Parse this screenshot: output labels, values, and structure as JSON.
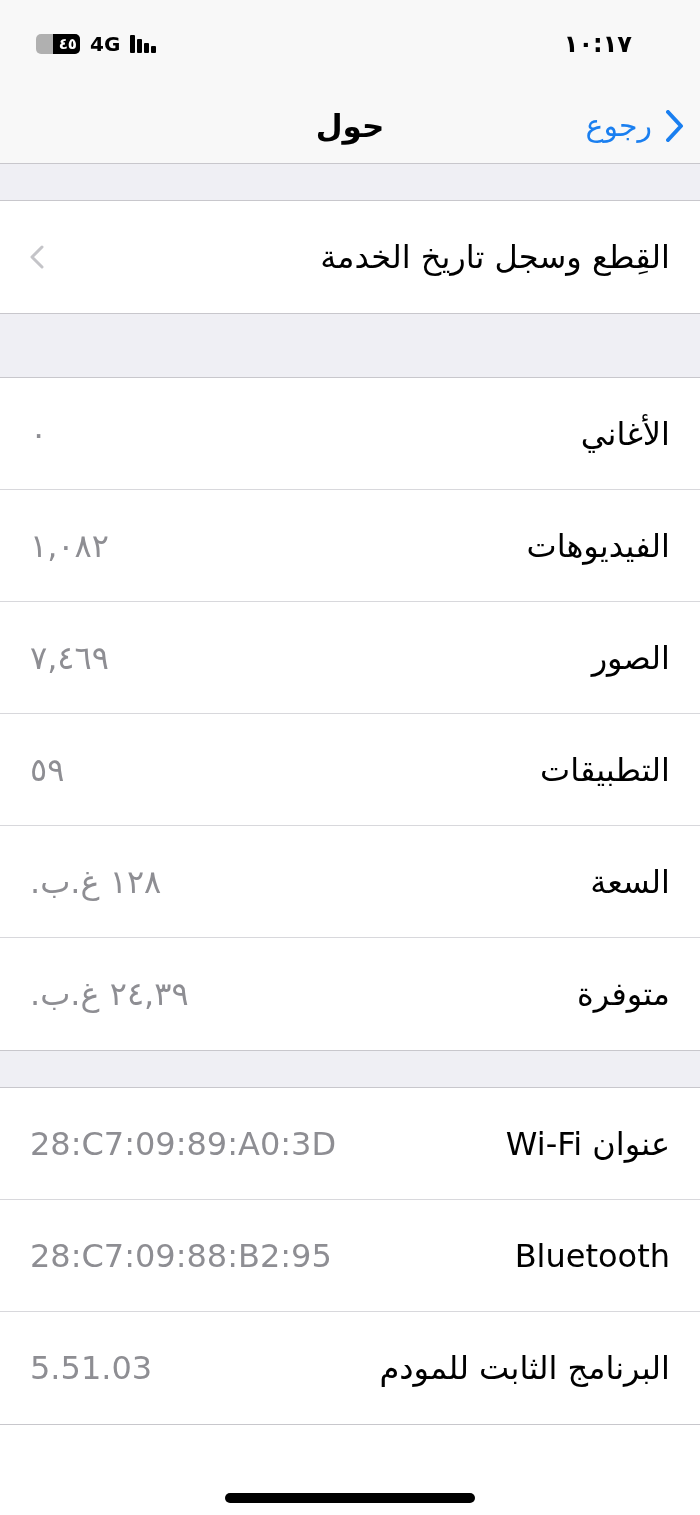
{
  "status_bar": {
    "time": "١٠:١٧",
    "network": "4G",
    "battery_percent": "٤٥"
  },
  "nav_bar": {
    "back_label": "رجوع",
    "title": "حول"
  },
  "sections": [
    {
      "rows": [
        {
          "kind": "link",
          "label": "القِطع وسجل تاريخ الخدمة"
        }
      ]
    },
    {
      "rows": [
        {
          "kind": "value",
          "label": "الأغاني",
          "value": "٠"
        },
        {
          "kind": "value",
          "label": "الفيديوهات",
          "value": "١,٠٨٢"
        },
        {
          "kind": "value",
          "label": "الصور",
          "value": "٧,٤٦٩"
        },
        {
          "kind": "value",
          "label": "التطبيقات",
          "value": "٥٩"
        },
        {
          "kind": "value",
          "label": "السعة",
          "value": "١٢٨ غ.ب."
        },
        {
          "kind": "value",
          "label": "متوفرة",
          "value": "٢٤,٣٩ غ.ب."
        }
      ]
    },
    {
      "rows": [
        {
          "kind": "value",
          "label": "عنوان Wi-Fi",
          "value": "28:C7:09:89:A0:3D"
        },
        {
          "kind": "value",
          "label": "Bluetooth",
          "value": "28:C7:09:88:B2:95"
        },
        {
          "kind": "value",
          "label": "البرنامج الثابت للمودم",
          "value": "5.51.03"
        }
      ]
    }
  ]
}
